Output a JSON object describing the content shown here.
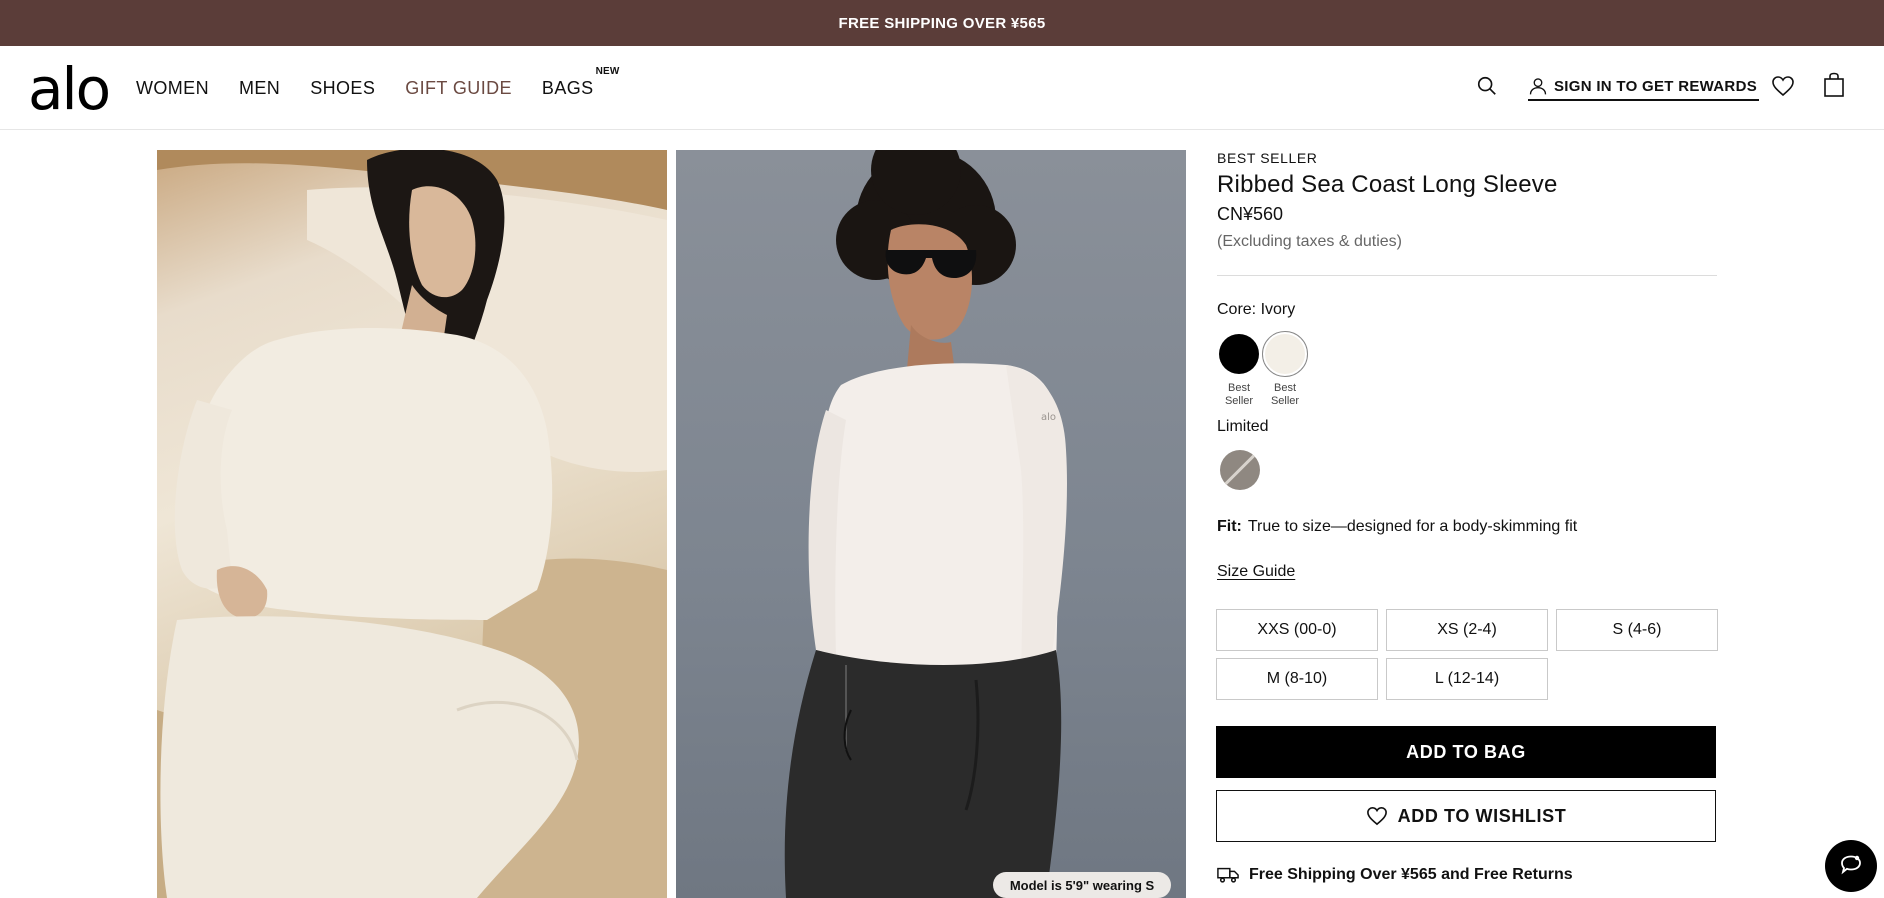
{
  "promo": {
    "text": "FREE SHIPPING OVER ¥565"
  },
  "header": {
    "logo": "alo",
    "nav": [
      {
        "label": "WOMEN"
      },
      {
        "label": "MEN"
      },
      {
        "label": "SHOES"
      },
      {
        "label": "GIFT GUIDE"
      },
      {
        "label": "BAGS",
        "badge": "NEW"
      }
    ],
    "signin_label": "SIGN IN TO GET REWARDS",
    "icons": [
      "search-icon",
      "user-icon",
      "heart-icon",
      "bag-icon"
    ]
  },
  "gallery": {
    "model_badge": "Model is 5'9\" wearing S"
  },
  "product": {
    "badge": "BEST SELLER",
    "title": "Ribbed Sea Coast Long Sleeve",
    "price": "CN¥560",
    "tax_note": "(Excluding taxes & duties)",
    "color_label": "Core: Ivory",
    "core_swatches": [
      {
        "name": "Black",
        "color": "#000000",
        "caption": "Best Seller"
      },
      {
        "name": "Ivory",
        "color": "#f3efe7",
        "caption": "Best Seller",
        "selected": true
      }
    ],
    "limited_label": "Limited",
    "limited_swatches": [
      {
        "color": "#8f8881"
      }
    ],
    "fit_label": "Fit:",
    "fit_text": "True to size—designed for a body-skimming fit",
    "size_guide": "Size Guide",
    "sizes": [
      "XXS (00-0)",
      "XS (2-4)",
      "S (4-6)",
      "M (8-10)",
      "L (12-14)"
    ],
    "add_to_bag": "ADD TO BAG",
    "add_to_wishlist": "ADD TO WISHLIST",
    "shipping_note": "Free Shipping Over ¥565 and Free Returns"
  },
  "colors": {
    "promo_bg": "#5b3d39",
    "gift_guide": "#6b4a42",
    "primary_button": "#000000"
  }
}
